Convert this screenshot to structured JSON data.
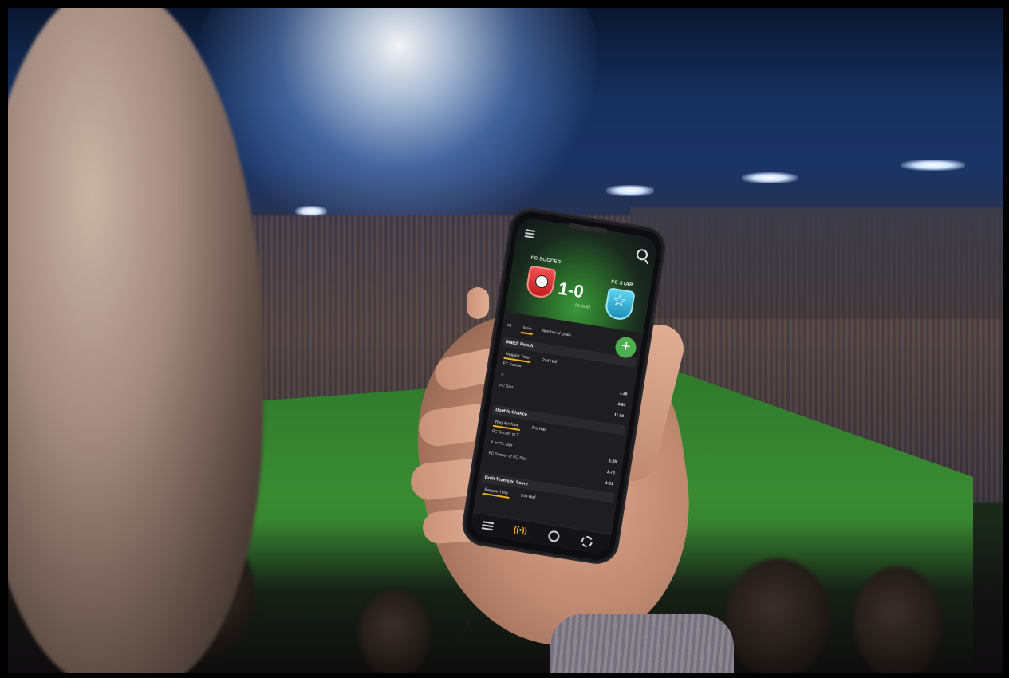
{
  "app": {
    "home_team": "FC SOCCER",
    "away_team": "FC STAR",
    "score": "1-0",
    "match_time": "20:45:42",
    "icons": [
      "menu-icon",
      "search-icon",
      "soccer-ball-icon",
      "star-icon",
      "plus-icon",
      "list-icon",
      "live-icon",
      "ball-icon",
      "gear-icon"
    ],
    "accent_color": "#f2b01e",
    "add_color": "#4caf50",
    "tabs": [
      "#1",
      "Main",
      "Number of goals"
    ],
    "sections": [
      {
        "title": "Match Result",
        "sub_tabs": [
          "Regular Time",
          "2nd Half"
        ],
        "rows": [
          {
            "label": "FC Soccer",
            "odd": ""
          },
          {
            "label": "X",
            "odd": "1.30"
          },
          {
            "label": "FC Star",
            "odd": "3.80"
          },
          {
            "label": "",
            "odd": "11.00"
          }
        ]
      },
      {
        "title": "Double Chance",
        "sub_tabs": [
          "Regular Time",
          "2nd Half"
        ],
        "rows": [
          {
            "label": "FC Soccer or X",
            "odd": ""
          },
          {
            "label": "X or FC Star",
            "odd": "1.25"
          },
          {
            "label": "FC Soccer or FC Star",
            "odd": "2.70"
          },
          {
            "label": "",
            "odd": "1.01"
          }
        ]
      },
      {
        "title": "Both Teams to Score",
        "sub_tabs": [
          "Regular Time",
          "2nd Half"
        ],
        "rows": []
      }
    ]
  }
}
